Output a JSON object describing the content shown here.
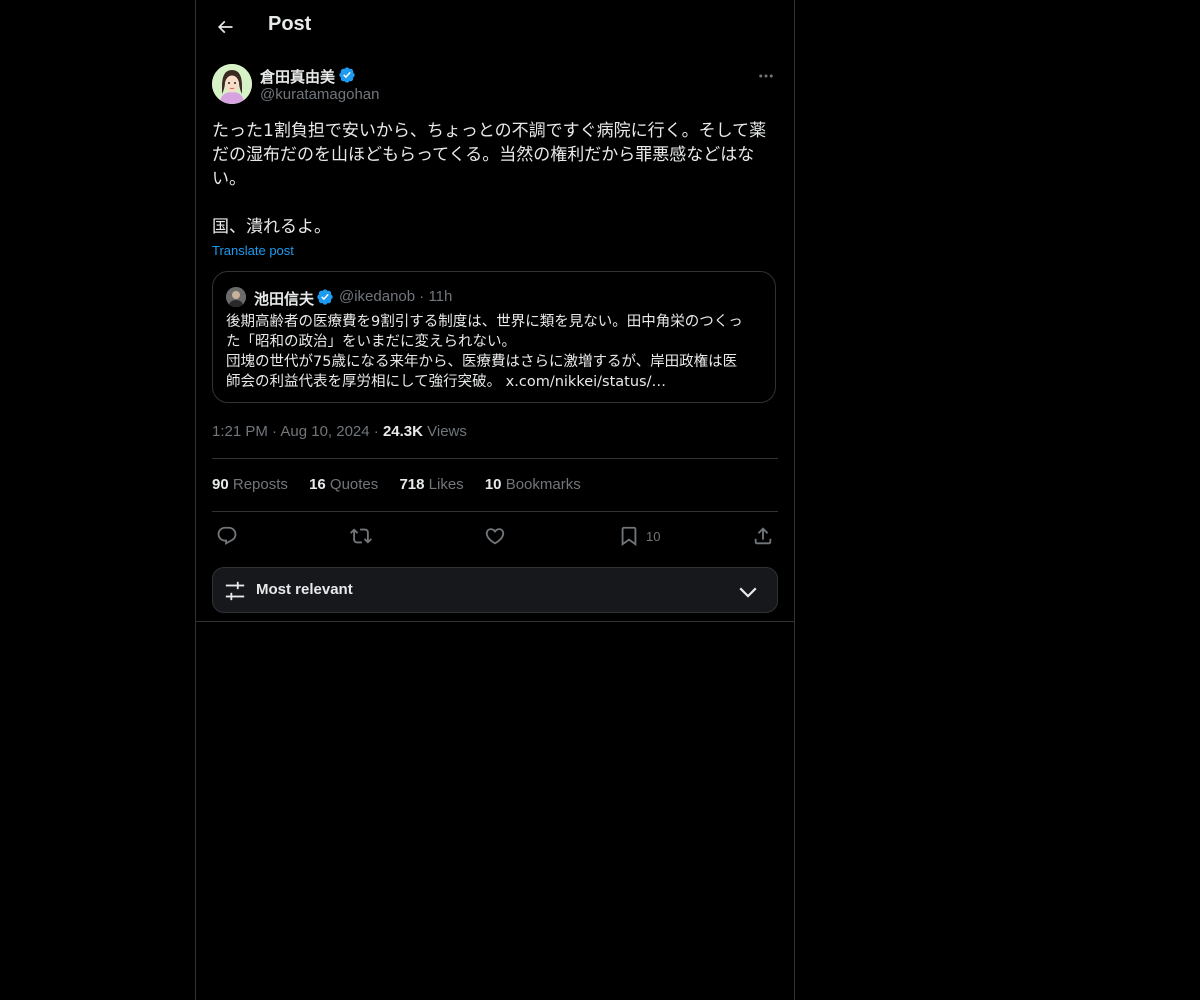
{
  "header": {
    "title": "Post",
    "back_icon": "arrow-left-icon"
  },
  "post": {
    "author_name": "倉田真由美",
    "author_handle": "@kuratamagohan",
    "text": "たった1割負担で安いから、ちょっとの不調ですぐ病院に行く。そして薬\nだの湿布だのを山ほどもらってくる。当然の権利だから罪悪感などはな\nい。\n\n国、潰れるよ。",
    "translate_label": "Translate post",
    "timestamp": "1:21 PM · Aug 10, 2024 · ",
    "views_count": "24.3K",
    "views_label": " Views"
  },
  "quote": {
    "author_name": "池田信夫",
    "author_handle": "@ikedanob · 11h",
    "text": "後期高齢者の医療費を9割引する制度は、世界に類を見ない。田中角栄のつくっ\nた「昭和の政治」をいまだに変えられない。\n団塊の世代が75歳になる来年から、医療費はさらに激増するが、岸田政権は医\n師会の利益代表を厚労相にして強行突破。 x.com/nikkei/status/…"
  },
  "stats": {
    "reposts_num": "90",
    "reposts_label": " Reposts",
    "quotes_num": "16",
    "quotes_label": " Quotes",
    "likes_num": "718",
    "likes_label": " Likes",
    "bookmarks_num": "10",
    "bookmarks_label": " Bookmarks"
  },
  "actions": {
    "bookmark_count": "10"
  },
  "sort": {
    "label": "Most relevant"
  },
  "colors": {
    "background": "#000000",
    "text": "#e7e9ea",
    "secondary": "#71767b",
    "accent": "#1d9bf0",
    "border": "#2f3336"
  }
}
